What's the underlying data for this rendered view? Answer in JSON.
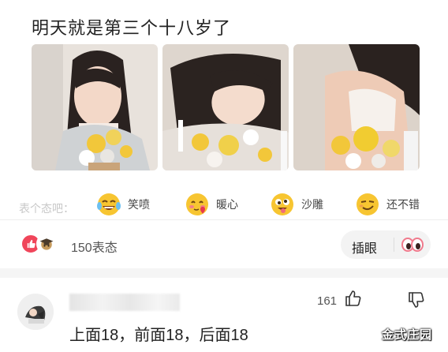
{
  "post": {
    "title": "明天就是第三个十八岁了",
    "photos": [
      "photo-1",
      "photo-2",
      "photo-3"
    ]
  },
  "reactions": {
    "label": "表个态吧：",
    "items": [
      {
        "label": "笑喷",
        "icon": "laughing-tears-emoji"
      },
      {
        "label": "暖心",
        "icon": "heart-blush-emoji"
      },
      {
        "label": "沙雕",
        "icon": "silly-face-emoji"
      },
      {
        "label": "还不错",
        "icon": "smug-smile-emoji"
      }
    ]
  },
  "stats": {
    "count_label": "150表态",
    "chip_label": "插眼",
    "like_color": "#f0455a"
  },
  "comment": {
    "like_count": "161",
    "text": "上面18，前面18，后面18"
  },
  "watermark": "金式庄园"
}
